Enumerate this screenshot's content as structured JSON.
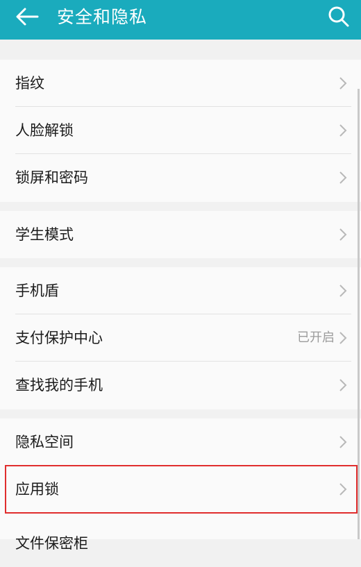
{
  "header": {
    "title": "安全和隐私",
    "background": "#1aabbd",
    "back_icon": "arrow-left-icon",
    "search_icon": "search-icon"
  },
  "groups": [
    {
      "items": [
        {
          "label": "指纹"
        },
        {
          "label": "人脸解锁"
        },
        {
          "label": "锁屏和密码"
        }
      ]
    },
    {
      "items": [
        {
          "label": "学生模式"
        }
      ]
    },
    {
      "items": [
        {
          "label": "手机盾"
        },
        {
          "label": "支付保护中心",
          "status": "已开启"
        },
        {
          "label": "查找我的手机"
        }
      ]
    },
    {
      "items": [
        {
          "label": "隐私空间"
        },
        {
          "label": "应用锁",
          "highlighted": true
        },
        {
          "label": "文件保密柜"
        }
      ]
    }
  ],
  "colors": {
    "highlight_border": "#e02d2d",
    "item_text": "#1b1b1b",
    "status_text": "#9b9b9b",
    "page_background": "#f1f1f1"
  },
  "row_chevron_icon": "chevron-right-icon"
}
